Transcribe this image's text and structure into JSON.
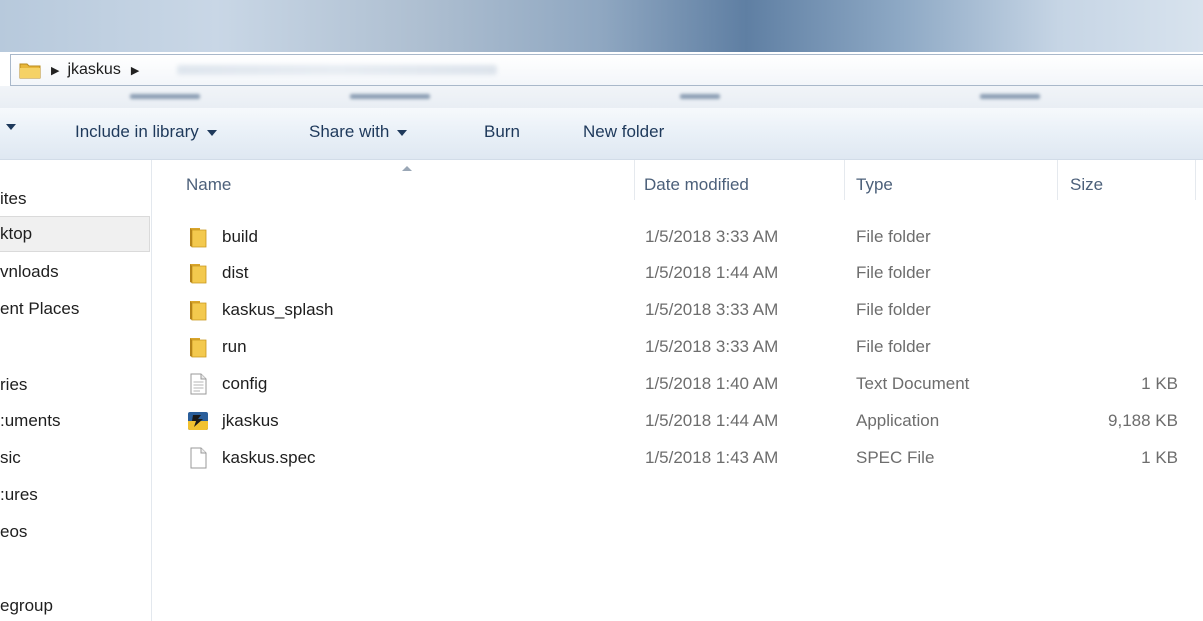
{
  "address": {
    "segments": [
      "jkaskus"
    ]
  },
  "toolbar": {
    "include_label": "Include in library",
    "share_label": "Share with",
    "burn_label": "Burn",
    "newfolder_label": "New folder"
  },
  "nav": {
    "items": [
      {
        "label": "ites"
      },
      {
        "label": "ktop"
      },
      {
        "label": "vnloads"
      },
      {
        "label": "ent Places"
      },
      {
        "label": "ries"
      },
      {
        "label": ":uments"
      },
      {
        "label": "sic"
      },
      {
        "label": ":ures"
      },
      {
        "label": "eos"
      },
      {
        "label": "egroup"
      }
    ]
  },
  "columns": {
    "name": "Name",
    "date": "Date modified",
    "type": "Type",
    "size": "Size"
  },
  "files": [
    {
      "name": "build",
      "date": "1/5/2018 3:33 AM",
      "type": "File folder",
      "size": "",
      "icon": "folder-icon"
    },
    {
      "name": "dist",
      "date": "1/5/2018 1:44 AM",
      "type": "File folder",
      "size": "",
      "icon": "folder-icon"
    },
    {
      "name": "kaskus_splash",
      "date": "1/5/2018 3:33 AM",
      "type": "File folder",
      "size": "",
      "icon": "folder-icon"
    },
    {
      "name": "run",
      "date": "1/5/2018 3:33 AM",
      "type": "File folder",
      "size": "",
      "icon": "folder-icon"
    },
    {
      "name": "config",
      "date": "1/5/2018 1:40 AM",
      "type": "Text Document",
      "size": "1 KB",
      "icon": "text-document-icon"
    },
    {
      "name": "jkaskus",
      "date": "1/5/2018 1:44 AM",
      "type": "Application",
      "size": "9,188 KB",
      "icon": "application-icon"
    },
    {
      "name": "kaskus.spec",
      "date": "1/5/2018 1:43 AM",
      "type": "SPEC File",
      "size": "1 KB",
      "icon": "file-icon"
    }
  ],
  "colors": {
    "accent": "#1e395b",
    "folder": "#e8b73a",
    "selected_bg": "#f0f0f0"
  }
}
